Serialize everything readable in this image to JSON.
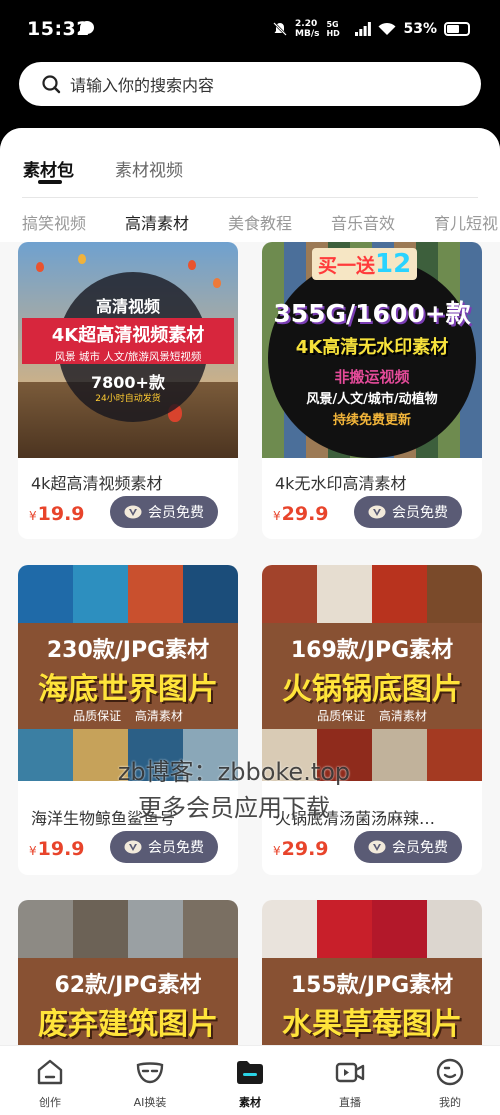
{
  "status_bar": {
    "time": "15:32",
    "speed_value": "2.20",
    "speed_unit": "MB/s",
    "network": "5G HD",
    "battery": "53%"
  },
  "search": {
    "placeholder": "请输入你的搜索内容"
  },
  "top_tabs": [
    "素材包",
    "素材视频"
  ],
  "categories": [
    "搞笑视频",
    "高清素材",
    "美食教程",
    "音乐音效",
    "育儿短视"
  ],
  "products": [
    {
      "title": "4k超高清视频素材",
      "currency": "¥",
      "price": "19.9",
      "button": "会员免费",
      "thumb": {
        "top": "高清视频",
        "main": "4K超高清视频素材",
        "sub": "风景 城市 人文/旅游风景短视频",
        "count": "7800+款",
        "note": "24小时自动发货"
      }
    },
    {
      "title": "4k无水印高清素材",
      "currency": "¥",
      "price": "29.9",
      "button": "会员免费",
      "thumb": {
        "promo_prefix": "买一送",
        "promo_num": "12",
        "big": "355G/1600+款",
        "mid": "4K高清无水印素材",
        "p1": "非搬运视频",
        "p2": "风景/人文/城市/动植物",
        "p3": "持续免费更新"
      }
    },
    {
      "title": "海洋生物鲸鱼鲨鱼号",
      "currency": "¥",
      "price": "19.9",
      "button": "会员免费",
      "thumb": {
        "line1": "230款/JPG素材",
        "line2": "海底世界图片",
        "line3": "品质保证 高清素材"
      }
    },
    {
      "title": "火锅底清汤菌汤麻辣…",
      "currency": "¥",
      "price": "29.9",
      "button": "会员免费",
      "thumb": {
        "line1": "169款/JPG素材",
        "line2": "火锅锅底图片",
        "line3": "品质保证 高清素材"
      }
    },
    {
      "title": "",
      "thumb": {
        "line1": "62款/JPG素材",
        "line2": "废弃建筑图片"
      }
    },
    {
      "title": "",
      "thumb": {
        "line1": "155款/JPG素材",
        "line2": "水果草莓图片"
      }
    }
  ],
  "watermark": {
    "line1": "zb博客：zbboke.top",
    "line2": "更多会员应用下载"
  },
  "bottom_nav": [
    {
      "label": "创作",
      "icon": "home-icon"
    },
    {
      "label": "AI换装",
      "icon": "mask-icon"
    },
    {
      "label": "素材",
      "icon": "folder-icon",
      "active": true
    },
    {
      "label": "直播",
      "icon": "live-camera-icon"
    },
    {
      "label": "我的",
      "icon": "profile-icon"
    }
  ],
  "colors": {
    "price": "#e8442b",
    "vip_button": "#5a5b75",
    "active_text": "#111111"
  }
}
